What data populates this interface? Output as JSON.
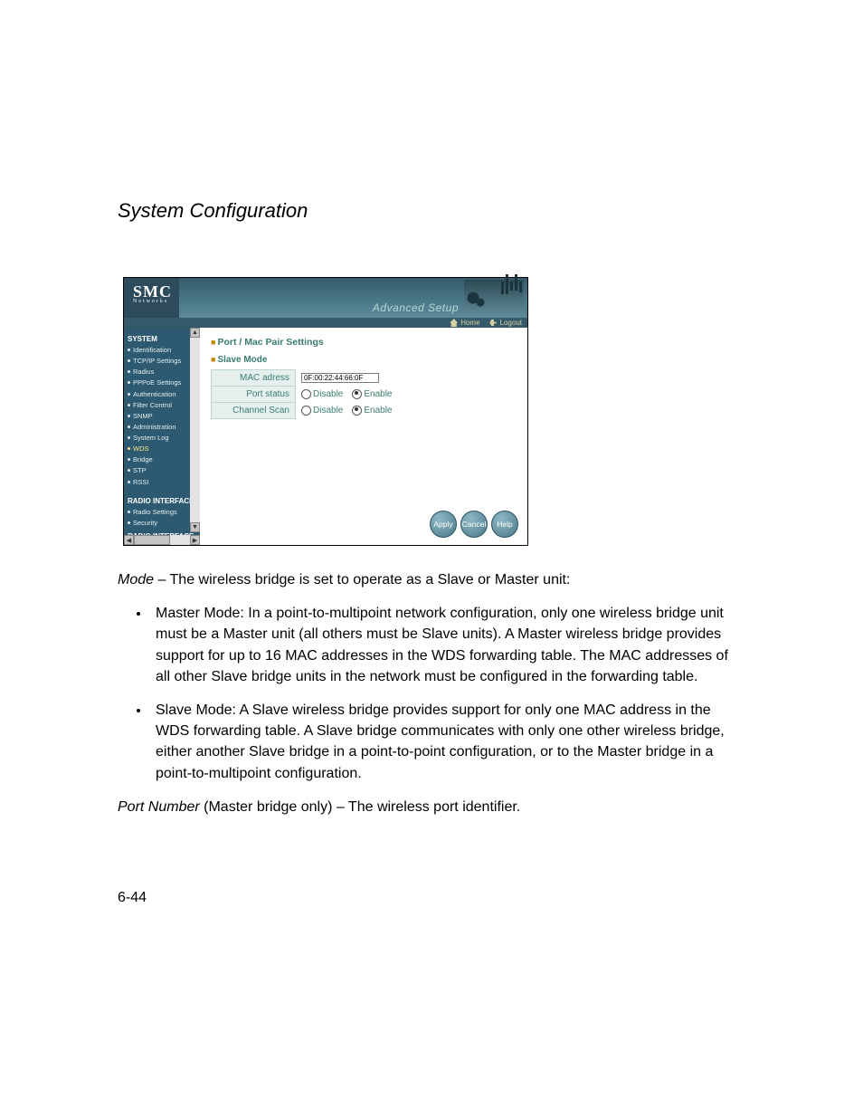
{
  "page": {
    "title": "System Configuration",
    "number": "6-44"
  },
  "screenshot": {
    "brand": "SMC",
    "brand_sub": "Networks",
    "advanced_setup": "Advanced Setup",
    "toolbar": {
      "home": "Home",
      "logout": "Logout"
    },
    "sidebar": {
      "group_system": "SYSTEM",
      "items_system": [
        "Identification",
        "TCP/IP Settings",
        "Radius",
        "PPPoE Settings",
        "Authentication",
        "Filter Control",
        "SNMP",
        "Administration",
        "System Log",
        "WDS",
        "Bridge",
        "STP",
        "RSSI"
      ],
      "group_radio": "RADIO INTERFACE",
      "items_radio": [
        "Radio Settings",
        "Security"
      ],
      "group_radio2": "RADIO INTERFACE"
    },
    "main": {
      "heading": "Port / Mac Pair Settings",
      "subhead": "Slave Mode",
      "rows": {
        "mac_label": "MAC adress",
        "mac_value": "0F:00:22:44:66:0F",
        "port_status_label": "Port status",
        "channel_scan_label": "Channel Scan",
        "disable": "Disable",
        "enable": "Enable"
      },
      "buttons": {
        "apply": "Apply",
        "cancel": "Cancel",
        "help": "Help"
      }
    }
  },
  "text": {
    "mode_label": "Mode",
    "mode_rest": " – The wireless bridge is set to operate as a Slave or Master unit:",
    "bullet1": "Master Mode: In a point-to-multipoint network configuration, only one wireless bridge unit must be a Master unit (all others must be Slave units). A Master wireless bridge provides support for up to 16 MAC addresses in the WDS forwarding table. The MAC addresses of all other Slave bridge units in the network must be configured in the forwarding table.",
    "bullet2": "Slave Mode: A Slave wireless bridge provides support for only one MAC address in the WDS forwarding table. A Slave bridge communicates with only one other wireless bridge, either another Slave bridge in a point-to-point configuration, or to the Master bridge in a point-to-multipoint configuration.",
    "port_label": "Port Number",
    "port_rest": " (Master bridge only) – The wireless port identifier."
  }
}
